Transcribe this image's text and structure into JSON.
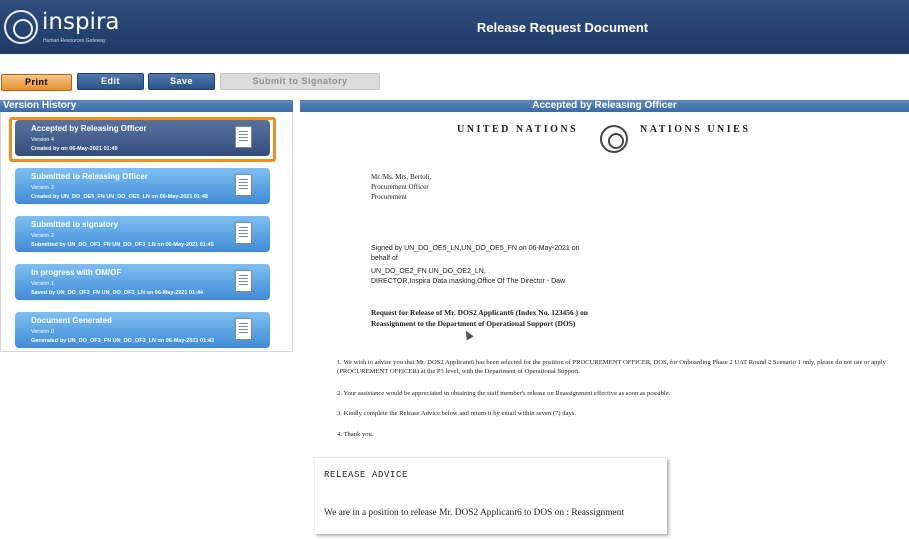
{
  "header": {
    "brand": "inspira",
    "brand_sub": "Human Resources Gateway",
    "doc_title": "Release Request Document"
  },
  "toolbar": {
    "print": "Print",
    "edit": "Edit",
    "save": "Save",
    "submit": "Submit to Signatory"
  },
  "version_history": {
    "title": "Version History",
    "cards": [
      {
        "title": "Accepted by Releasing Officer",
        "version": "Version 4",
        "meta": "Created by on 06-May-2021 01:49"
      },
      {
        "title": "Submitted to Releasing Officer",
        "version": "Version 3",
        "meta": "Created by UN_DO_OE5_FN UN_DO_OE5_LN on 06-May-2021 01:48"
      },
      {
        "title": "Submitted to signatory",
        "version": "Version 2",
        "meta": "Submitted by UN_DO_OF3_FN UN_DO_OF3_LN on 06-May-2021 01:45"
      },
      {
        "title": "In progress with OM/OF",
        "version": "Version 1",
        "meta": "Saved by UN_DO_OF3_FN UN_DO_OF3_LN on 06-May-2021 01:44"
      },
      {
        "title": "Document Generated",
        "version": "Version 0",
        "meta": "Generated by UN_DO_OF3_FN UN_DO_OF3_LN on 06-May-2021 01:43"
      }
    ]
  },
  "document": {
    "panel_title": "Accepted by Releasing Officer",
    "un_left": "UNITED NATIONS",
    "un_right": "NATIONS UNIES",
    "addr_lines": [
      "Mr./Ms. Mrs. Bertoli,",
      "Procurement Officer",
      "Procurement"
    ],
    "signed_text": "Signed by UN_DO_OE5_LN,UN_DO_OE5_FN on 06-May-2021 on behalf of",
    "from_lines": [
      "UN_DO_OE2_FN UN_DO_OE2_LN,",
      "DIRECTOR,Inspira Data masking,Office Of The Director - Daw"
    ],
    "subject_lines": [
      "Request for Release of Mr. DOS2 Applicant6 (Index No. 123456 ) on",
      "Reassignment to the Department of Operational Support (DOS)"
    ],
    "paragraphs": [
      "1. We wish to advise you that Mr. DOS2 Applicant6 has been selected for the position of PROCUREMENT OFFICER, DOS, for Onboarding Phase 2 UAT Round 2 Scenario 1 only, please do not use or apply (PROCUREMENT OFFICER) at the P3 level, with the Department of Operational Support.",
      "2. Your assistance would be appreciated in obtaining the staff member's release on Reassignment effective as soon as possible.",
      "3. Kindly complete the Release Advice below and return it by email within seven (7) days.",
      "4. Thank you."
    ],
    "advice_title": "RELEASE ADVICE",
    "advice_text": "We are in a position to release Mr. DOS2 Applicant6 to DOS on : Reassignment"
  }
}
